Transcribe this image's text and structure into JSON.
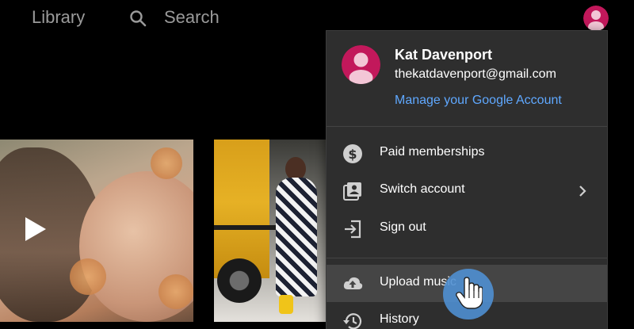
{
  "topbar": {
    "nav": {
      "library_label": "Library",
      "search_label": "Search"
    }
  },
  "menu": {
    "user": {
      "name": "Kat Davenport",
      "email": "thekatdavenport@gmail.com",
      "manage_link": "Manage your Google Account"
    },
    "items": [
      {
        "label": "Paid memberships",
        "icon": "dollar-circle-icon"
      },
      {
        "label": "Switch account",
        "icon": "switch-account-icon",
        "has_submenu": true
      },
      {
        "label": "Sign out",
        "icon": "sign-out-icon"
      },
      {
        "label": "Upload music",
        "icon": "cloud-upload-icon",
        "highlighted": true
      },
      {
        "label": "History",
        "icon": "history-icon"
      }
    ]
  },
  "colors": {
    "avatar": "#c2185b",
    "link": "#5fa8ff",
    "menu_bg": "#2e2e2e",
    "highlight_bg": "#454545",
    "cursor_circle": "#4f8fd1"
  }
}
